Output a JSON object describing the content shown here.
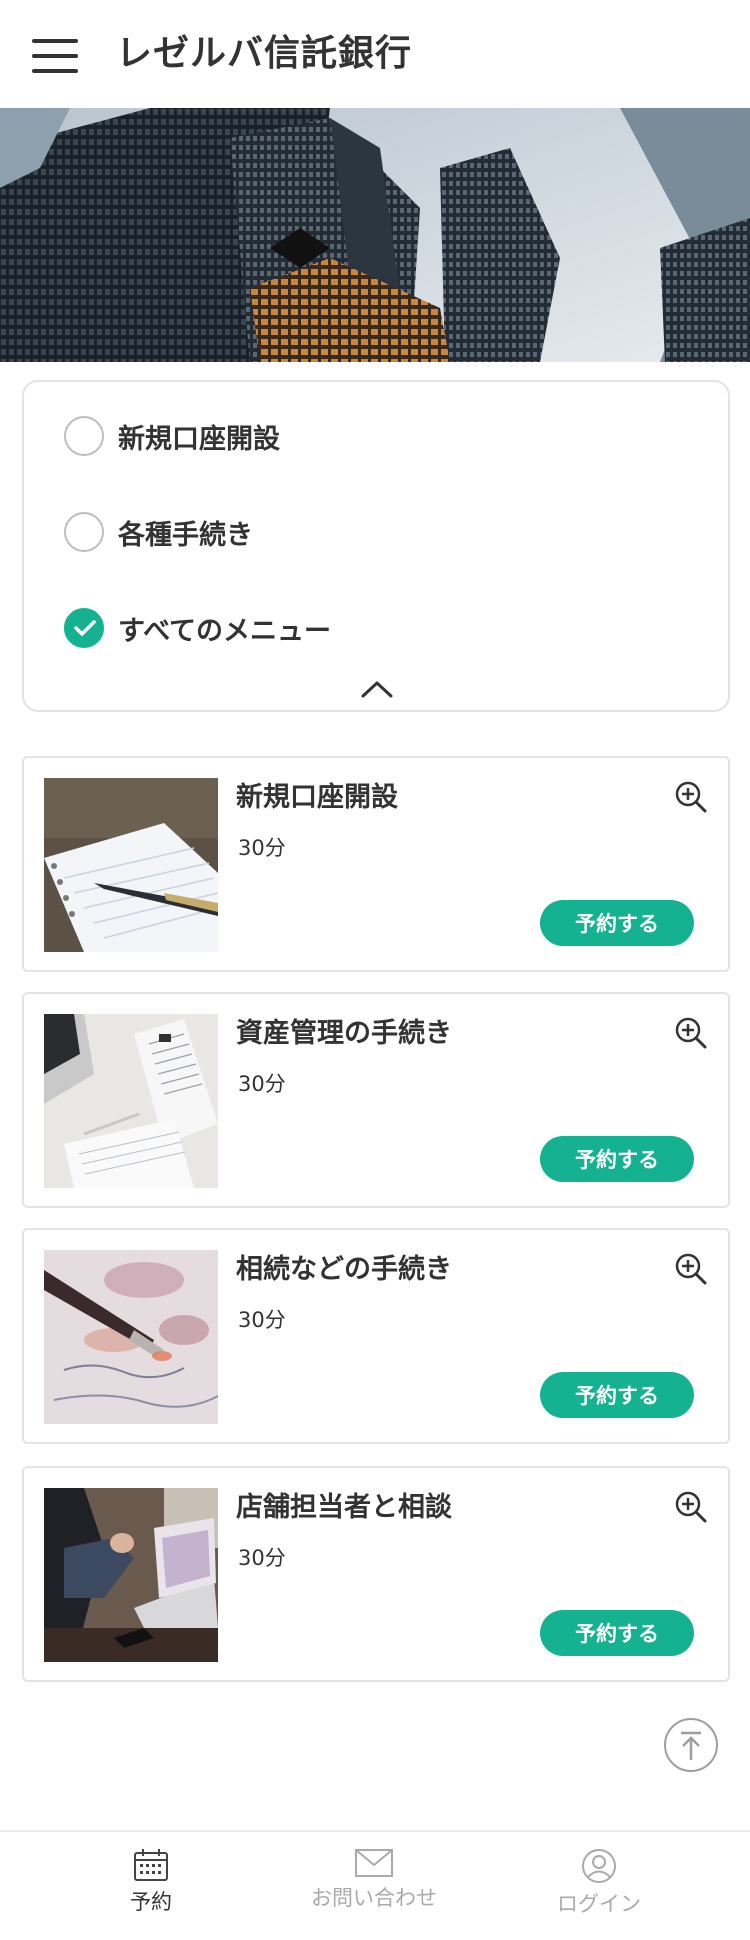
{
  "header": {
    "title": "レゼルバ信託銀行",
    "menu_icon": "hamburger-menu-icon"
  },
  "hero": {
    "image": "city-skyscrapers-photo"
  },
  "filter": {
    "options": [
      {
        "label": "新規口座開設",
        "checked": false
      },
      {
        "label": "各種手続き",
        "checked": false
      },
      {
        "label": "すべてのメニュー",
        "checked": true
      }
    ],
    "collapse_icon": "chevron-up-icon"
  },
  "menus": [
    {
      "title": "新規口座開設",
      "duration": "30分",
      "button": "予約する",
      "image": "notebook-pen-photo"
    },
    {
      "title": "資産管理の手続き",
      "duration": "30分",
      "button": "予約する",
      "image": "documents-laptop-photo"
    },
    {
      "title": "相続などの手続き",
      "duration": "30分",
      "button": "予約する",
      "image": "fountain-pen-writing-photo"
    },
    {
      "title": "店舗担当者と相談",
      "duration": "30分",
      "button": "予約する",
      "image": "business-meeting-laptop-photo"
    }
  ],
  "scroll_top_icon": "arrow-up-circle-icon",
  "bottom_nav": {
    "items": [
      {
        "label": "予約",
        "icon": "calendar-icon",
        "active": true
      },
      {
        "label": "お問い合わせ",
        "icon": "envelope-icon",
        "active": false
      },
      {
        "label": "ログイン",
        "icon": "user-icon",
        "active": false
      }
    ]
  },
  "colors": {
    "accent": "#14b290",
    "text": "#333333",
    "border": "#e4e4e4",
    "inactive": "#aaaaaa"
  }
}
